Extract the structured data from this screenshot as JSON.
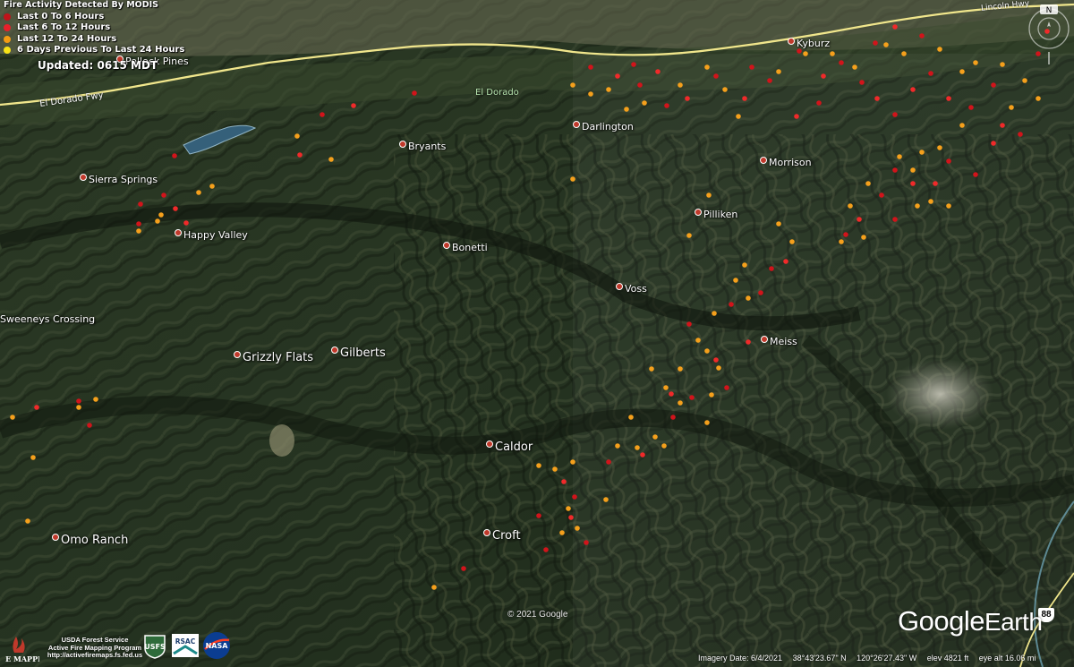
{
  "legend": {
    "title": "Fire Activity Detected By MODIS",
    "items": [
      {
        "label": "Last 0 To 6 Hours",
        "color": "#c0131a"
      },
      {
        "label": "Last 6 To 12 Hours",
        "color": "#e8202a"
      },
      {
        "label": "Last 12 To 24 Hours",
        "color": "#f39c12"
      },
      {
        "label": "6 Days Previous To Last 24 Hours",
        "color": "#f7e217"
      }
    ]
  },
  "updated": "Updated: 0615 MDT",
  "roads": {
    "highway_50_west": "El Dorado Fwy",
    "highway_50_east": "Lincoln Hwy",
    "highway_88": "88"
  },
  "places": [
    {
      "id": "pollock-pines",
      "name": "Pollock Pines",
      "size": "small"
    },
    {
      "id": "el-dorado",
      "name": "El Dorado",
      "size": "small",
      "green": true
    },
    {
      "id": "kyburz",
      "name": "Kyburz",
      "size": "small"
    },
    {
      "id": "darlington",
      "name": "Darlington",
      "size": "small"
    },
    {
      "id": "bryants",
      "name": "Bryants",
      "size": "small"
    },
    {
      "id": "morrison",
      "name": "Morrison",
      "size": "small"
    },
    {
      "id": "sierra-springs",
      "name": "Sierra Springs",
      "size": "small"
    },
    {
      "id": "happy-valley",
      "name": "Happy Valley",
      "size": "small"
    },
    {
      "id": "bonetti",
      "name": "Bonetti",
      "size": "small"
    },
    {
      "id": "pilliken",
      "name": "Pilliken",
      "size": "small"
    },
    {
      "id": "voss",
      "name": "Voss",
      "size": "small"
    },
    {
      "id": "sweeneys-crossing",
      "name": "Sweeneys Crossing",
      "size": "small"
    },
    {
      "id": "meiss",
      "name": "Meiss",
      "size": "small"
    },
    {
      "id": "grizzly-flats",
      "name": "Grizzly Flats",
      "size": "large"
    },
    {
      "id": "gilberts",
      "name": "Gilberts",
      "size": "large"
    },
    {
      "id": "caldor",
      "name": "Caldor",
      "size": "large"
    },
    {
      "id": "croft",
      "name": "Croft",
      "size": "large"
    },
    {
      "id": "omo-ranch",
      "name": "Omo Ranch",
      "size": "large"
    }
  ],
  "copyright": "© 2021 Google",
  "brand": {
    "google": "Google",
    "earth": "Earth"
  },
  "status": {
    "imagery_date": "Imagery Date: 6/4/2021",
    "lat": "38°43'23.67\" N",
    "lon": "120°26'27.43\" W",
    "elev": "elev  4821 ft",
    "eye_alt": "eye alt  16.06 mi"
  },
  "credits": {
    "line1": "USDA Forest Service",
    "line2": "Active Fire Mapping Program",
    "line3": "http://activefiremaps.fs.fed.us"
  },
  "agencies": [
    "FIRE MAPPING",
    "USFS",
    "RSAC",
    "NASA"
  ],
  "compass": "N"
}
